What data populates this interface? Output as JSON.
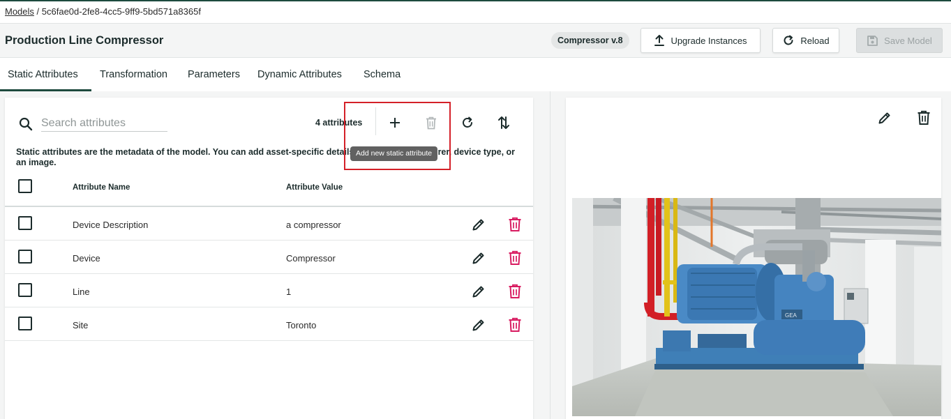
{
  "breadcrumb": {
    "root": "Models",
    "separator": " / ",
    "current": "5c6fae0d-2fe8-4cc5-9ff9-5bd571a8365f"
  },
  "header": {
    "title": "Production Line Compressor",
    "version_badge": "Compressor v.8",
    "upgrade_label": "Upgrade Instances",
    "reload_label": "Reload",
    "save_label": "Save Model"
  },
  "tabs": [
    {
      "label": "Static Attributes",
      "active": true
    },
    {
      "label": "Transformation"
    },
    {
      "label": "Parameters"
    },
    {
      "label": "Dynamic Attributes"
    },
    {
      "label": "Schema"
    }
  ],
  "toolbar": {
    "search_placeholder": "Search attributes",
    "count_label": "4 attributes",
    "tooltip": "Add new static attribute"
  },
  "description": "Static attributes are the metadata of the model. You can add asset-specific details, such as manufacturer, device type, or an image.",
  "table": {
    "columns": [
      "Attribute Name",
      "Attribute Value"
    ],
    "rows": [
      {
        "name": "Device Description",
        "value": "a compressor"
      },
      {
        "name": "Device",
        "value": "Compressor"
      },
      {
        "name": "Line",
        "value": "1"
      },
      {
        "name": "Site",
        "value": "Toronto"
      }
    ]
  },
  "colors": {
    "brand": "#1d4a3e",
    "delete": "#d81b60",
    "highlight": "#d42028"
  },
  "icons": [
    "search-icon",
    "plus-icon",
    "trash-icon",
    "refresh-icon",
    "sort-icon",
    "pencil-icon",
    "upload-icon",
    "reload-icon",
    "save-icon"
  ]
}
